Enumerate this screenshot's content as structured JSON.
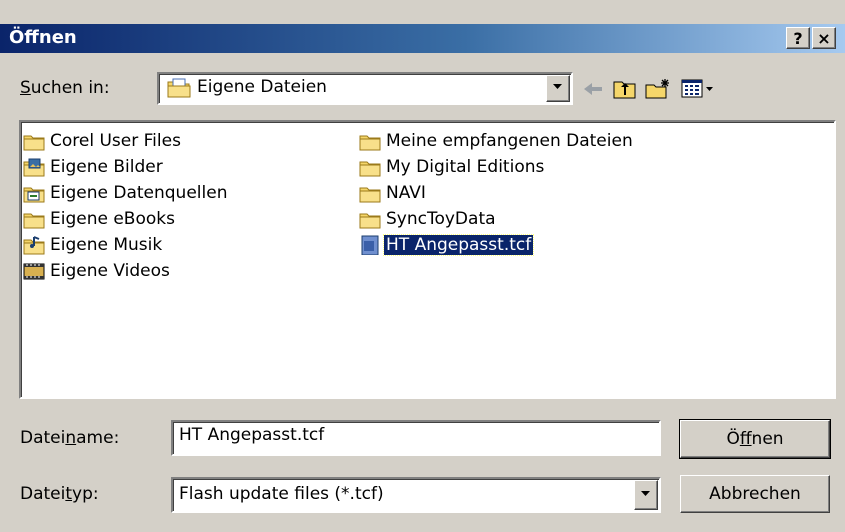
{
  "window": {
    "title": "Öffnen",
    "help_button": "?",
    "close_button": "×"
  },
  "look_in": {
    "label_prefix": "",
    "label_accel": "S",
    "label_rest": "uchen in:",
    "value": "Eigene Dateien"
  },
  "toolbar": {
    "icons": [
      "back-arrow-icon",
      "up-folder-icon",
      "new-folder-icon",
      "view-menu-icon"
    ]
  },
  "files": {
    "column1": [
      {
        "name": "Corel User Files",
        "icon": "folder-icon"
      },
      {
        "name": "Eigene Bilder",
        "icon": "pictures-folder-icon"
      },
      {
        "name": "Eigene Datenquellen",
        "icon": "data-sources-folder-icon"
      },
      {
        "name": "Eigene eBooks",
        "icon": "folder-icon"
      },
      {
        "name": "Eigene Musik",
        "icon": "music-folder-icon"
      },
      {
        "name": "Eigene Videos",
        "icon": "videos-folder-icon"
      }
    ],
    "column2": [
      {
        "name": "Meine empfangenen Dateien",
        "icon": "folder-icon"
      },
      {
        "name": "My Digital Editions",
        "icon": "folder-icon"
      },
      {
        "name": "NAVI",
        "icon": "folder-icon"
      },
      {
        "name": "SyncToyData",
        "icon": "folder-icon"
      },
      {
        "name": "HT Angepasst.tcf",
        "icon": "file-icon",
        "selected": true
      }
    ]
  },
  "filename": {
    "label_prefix": "Datei",
    "label_accel": "n",
    "label_rest": "ame:",
    "value": "HT Angepasst.tcf"
  },
  "filetype": {
    "label_prefix": "Datei",
    "label_accel": "t",
    "label_rest": "yp:",
    "value": "Flash update files (*.tcf)"
  },
  "buttons": {
    "open_prefix": "Ö",
    "open_accel": "f",
    "open_rest": "fnen",
    "cancel": "Abbrechen"
  },
  "colors": {
    "title_start": "#0a246a",
    "title_end": "#a6caf0",
    "face": "#d4d0c8",
    "selection": "#0a246a"
  }
}
